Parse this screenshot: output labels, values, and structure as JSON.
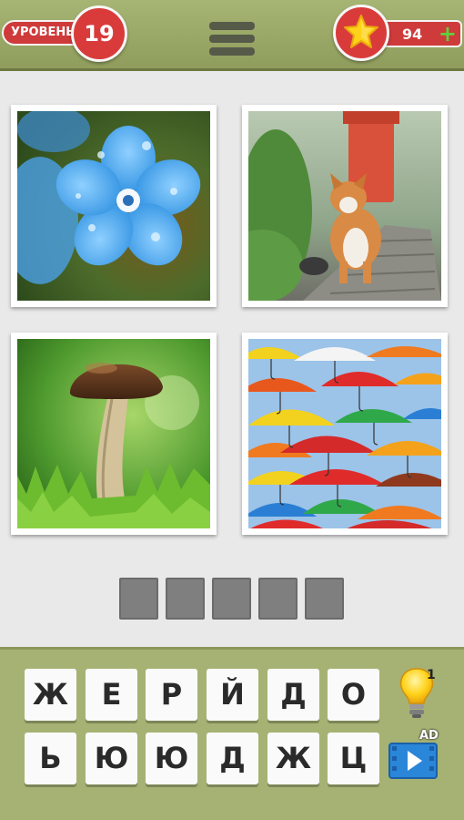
{
  "header": {
    "level_label": "УРОВЕНЬ",
    "level_number": "19",
    "coins": "94",
    "coins_plus": "+",
    "star_icon": "star-icon",
    "menu_icon": "hamburger-menu-icon"
  },
  "pictures": [
    {
      "name": "forget-me-not-flower-picture"
    },
    {
      "name": "dog-in-rain-picture"
    },
    {
      "name": "mushroom-picture"
    },
    {
      "name": "colorful-umbrellas-picture"
    }
  ],
  "answer": {
    "slot_count": 5
  },
  "keyboard": {
    "row1": [
      "Ж",
      "Е",
      "Р",
      "Й",
      "Д",
      "О"
    ],
    "row2": [
      "Ь",
      "Ю",
      "Ю",
      "Д",
      "Ж",
      "Ц"
    ]
  },
  "hint": {
    "icon": "lightbulb-icon",
    "count": "1"
  },
  "video": {
    "icon": "video-play-icon",
    "badge": "AD"
  },
  "colors": {
    "topbar": "#9aa865",
    "badge_red": "#d93b3b",
    "slot_gray": "#7f7f7f",
    "keyboard_bg": "#a6b274"
  }
}
